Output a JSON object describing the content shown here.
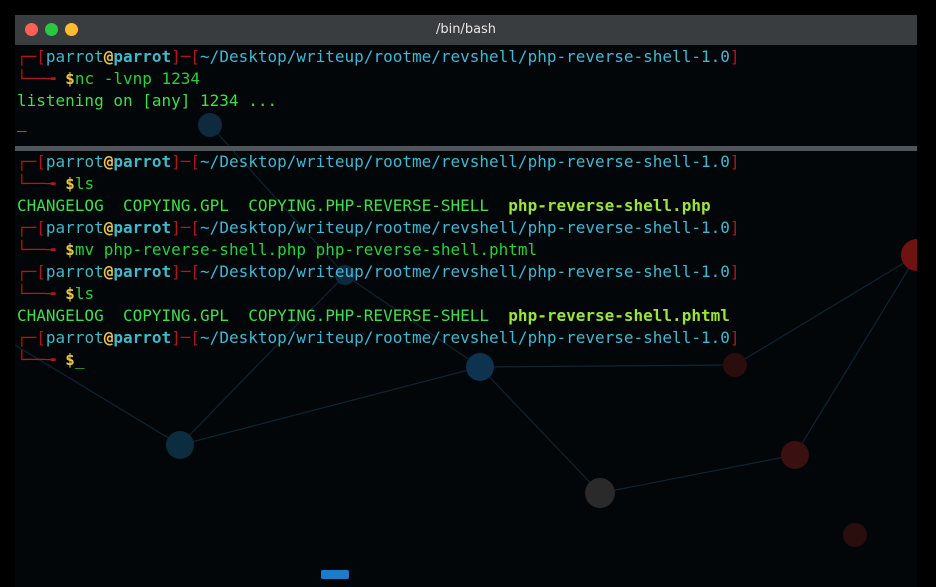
{
  "window": {
    "title": "/bin/bash"
  },
  "prompt": {
    "user": "parrot",
    "at": "@",
    "host": "parrot",
    "path": "~/Desktop/writeup/rootme/revshell/php-reverse-shell-1.0",
    "symbol": "$"
  },
  "pane_top": {
    "command": "nc -lvnp 1234",
    "output": "listening on [any] 1234 ...",
    "cursor": "_"
  },
  "pane_bottom": {
    "cmd1": "ls",
    "ls1_files": [
      "CHANGELOG",
      "COPYING.GPL",
      "COPYING.PHP-REVERSE-SHELL"
    ],
    "ls1_highlight": "php-reverse-shell.php",
    "cmd2": "mv php-reverse-shell.php php-reverse-shell.phtml",
    "cmd3": "ls",
    "ls2_files": [
      "CHANGELOG",
      "COPYING.GPL",
      "COPYING.PHP-REVERSE-SHELL"
    ],
    "ls2_highlight": "php-reverse-shell.phtml",
    "cursor": "_"
  },
  "colors": {
    "red": "#b0161c",
    "cyan": "#3fb9c9",
    "green": "#28d13a",
    "yellow": "#e8c547",
    "accent": "#1c7cc8"
  }
}
